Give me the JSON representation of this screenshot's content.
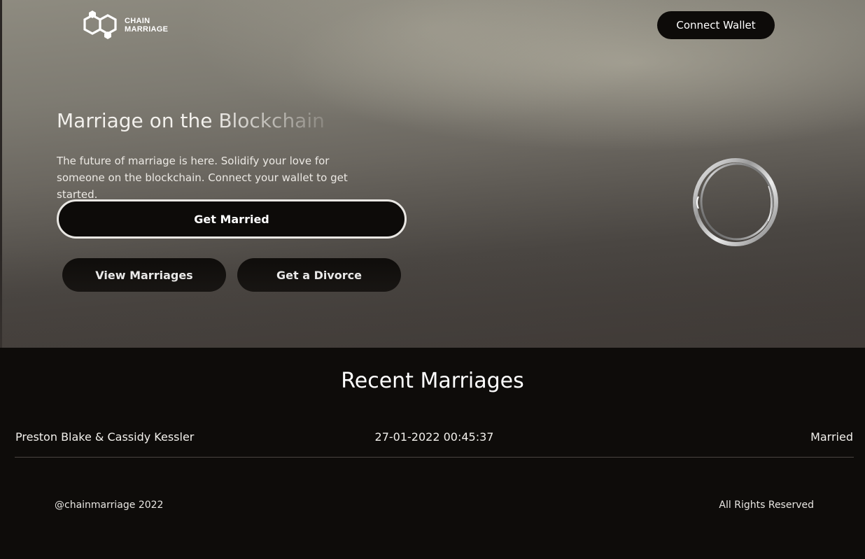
{
  "header": {
    "logo_line1": "CHAIN",
    "logo_line2": "MARRIAGE",
    "connect_wallet_label": "Connect Wallet"
  },
  "hero": {
    "title": "Marriage on the Blockchain",
    "description": "The future of marriage is here. Solidify your love for someone on the blockchain. Connect your wallet to get started.",
    "get_married_label": "Get Married",
    "view_marriages_label": "View Marriages",
    "get_divorce_label": "Get a Divorce",
    "image_icon": "wedding-ring-icon"
  },
  "recent": {
    "title": "Recent Marriages",
    "rows": [
      {
        "names": "Preston Blake & Cassidy Kessler",
        "date": "27-01-2022 00:45:37",
        "status": "Married"
      }
    ]
  },
  "footer": {
    "copyright": "@chainmarriage 2022",
    "rights": "All Rights Reserved"
  },
  "colors": {
    "button_bg": "#0d0b09",
    "page_bg": "#0e0c0a",
    "text": "#ffffff"
  }
}
